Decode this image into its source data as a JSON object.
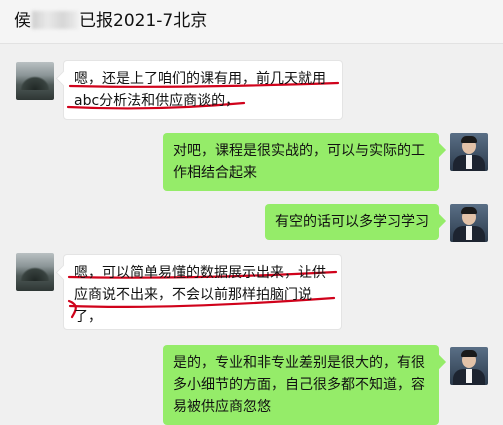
{
  "window": {
    "title_prefix": "侯",
    "title_suffix": "已报2021-7北京"
  },
  "messages": [
    {
      "side": "left",
      "text": "嗯，还是上了咱们的课有用，前几天就用abc分析法和供应商谈的，"
    },
    {
      "side": "right",
      "text": "对吧，课程是很实战的，可以与实际的工作相结合起来"
    },
    {
      "side": "right",
      "text": "有空的话可以多学习学习"
    },
    {
      "side": "left",
      "text": "嗯，可以简单易懂的数据展示出来，让供应商说不出来，不会以前那样拍脑门说了，"
    },
    {
      "side": "right",
      "text": "是的，专业和非专业差别是很大的，有很多小细节的方面，自己很多都不知道，容易被供应商忽悠"
    }
  ],
  "colors": {
    "incoming_bubble": "#ffffff",
    "outgoing_bubble": "#95ec69",
    "annotation": "#d0021b"
  }
}
